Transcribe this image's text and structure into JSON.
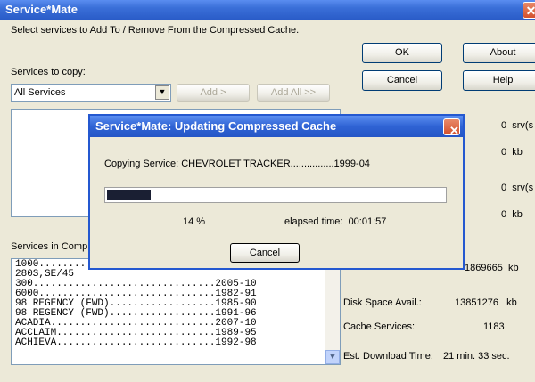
{
  "window": {
    "title": "Service*Mate"
  },
  "main": {
    "instruction": "Select services to Add To / Remove From the Compressed Cache.",
    "services_to_copy_label": "Services to copy:",
    "services_select_value": "All Services",
    "add_label": "Add >",
    "add_all_label": "Add All >>",
    "services_in_comp_label": "Services in Comp",
    "ok_label": "OK",
    "about_label": "About",
    "cancel_label": "Cancel",
    "help_label": "Help",
    "stats": [
      {
        "value": "0",
        "unit": "srv(s"
      },
      {
        "value": "0",
        "unit": "kb"
      },
      {
        "value": "0",
        "unit": "srv(s"
      },
      {
        "value": "0",
        "unit": "kb"
      }
    ],
    "cache_size_value": "1869665",
    "cache_size_unit": "kb",
    "disk_space_label": "Disk Space Avail.:",
    "disk_space_value": "13851276",
    "disk_space_unit": "kb",
    "cache_services_label": "Cache Services:",
    "cache_services_value": "1183",
    "download_label": "Est. Download Time:",
    "download_value": "21 min. 33 sec."
  },
  "list_items": [
    "1000........",
    "280S,SE/45",
    "300...............................2005-10",
    "6000..............................1982-91",
    "98 REGENCY (FWD)..................1985-90",
    "98 REGENCY (FWD)..................1991-96",
    "ACADIA............................2007-10",
    "ACCLAIM...........................1989-95",
    "ACHIEVA...........................1992-98"
  ],
  "dialog": {
    "title": "Service*Mate:  Updating Compressed Cache",
    "status": "Copying Service: CHEVROLET TRACKER................1999-04",
    "progress_percent": 14,
    "percent_text": "14  %",
    "elapsed_label": "elapsed time:",
    "elapsed_value": "00:01:57",
    "cancel_label": "Cancel"
  }
}
